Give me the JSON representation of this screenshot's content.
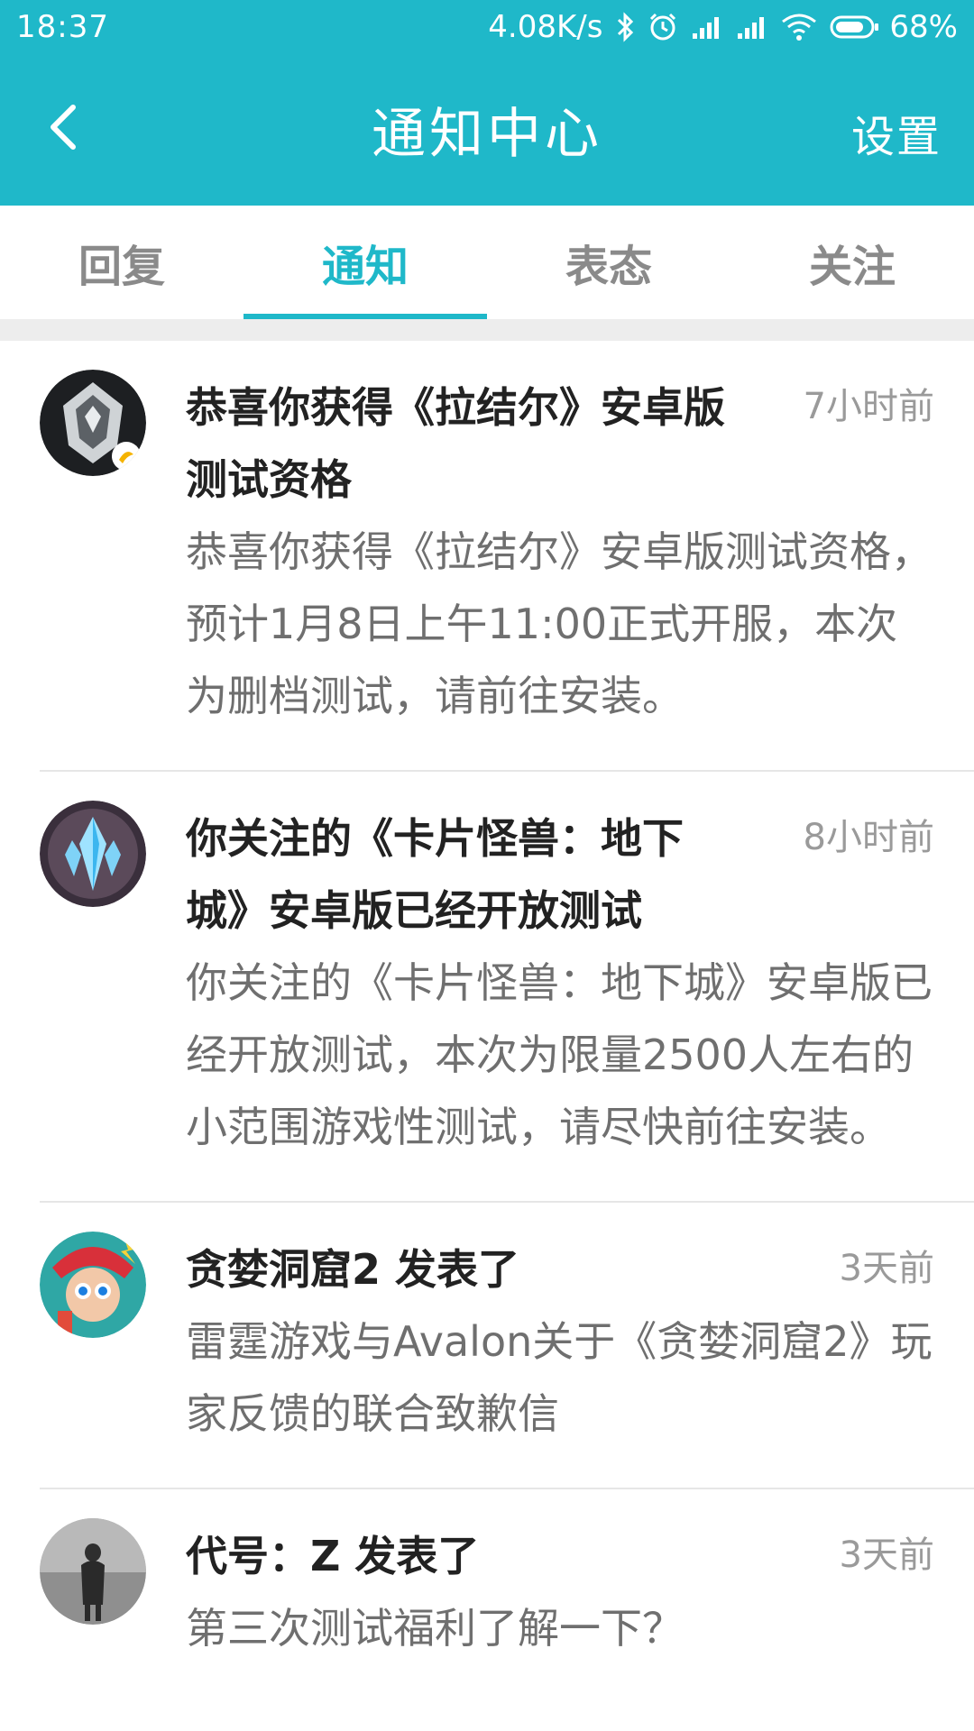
{
  "status": {
    "time": "18:37",
    "net_speed": "4.08K/s",
    "battery": "68%"
  },
  "header": {
    "title": "通知中心",
    "settings": "设置"
  },
  "tabs": [
    {
      "label": "回复",
      "active": false
    },
    {
      "label": "通知",
      "active": true
    },
    {
      "label": "表态",
      "active": false
    },
    {
      "label": "关注",
      "active": false
    }
  ],
  "notifications": [
    {
      "title": "恭喜你获得《拉结尔》安卓版测试资格",
      "time": "7小时前",
      "body": "恭喜你获得《拉结尔》安卓版测试资格，预计1月8日上午11:00正式开服，本次为删档测试，请前往安装。"
    },
    {
      "title": "你关注的《卡片怪兽：地下城》安卓版已经开放测试",
      "time": "8小时前",
      "body": "你关注的《卡片怪兽：地下城》安卓版已经开放测试，本次为限量2500人左右的小范围游戏性测试，请尽快前往安装。"
    },
    {
      "title": "贪婪洞窟2 发表了",
      "time": "3天前",
      "body": "雷霆游戏与Avalon关于《贪婪洞窟2》玩家反馈的联合致歉信"
    },
    {
      "title": "代号：Z 发表了",
      "time": "3天前",
      "body": "第三次测试福利了解一下？"
    }
  ],
  "colors": {
    "accent": "#1fb8c9",
    "title_text": "#222222",
    "body_text": "#6f6f6f",
    "time_text": "#9a9a9a"
  }
}
